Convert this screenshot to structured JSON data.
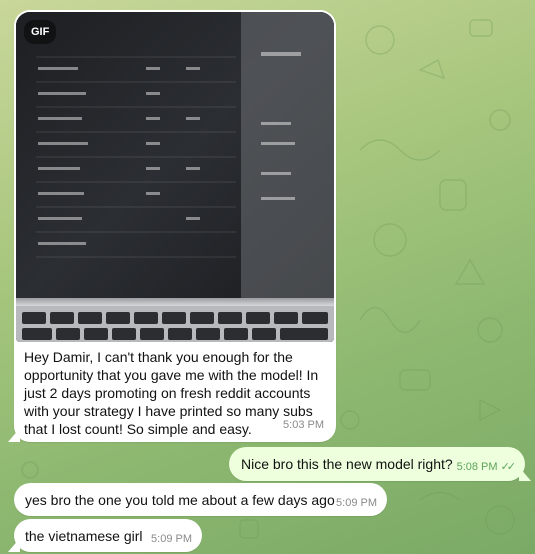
{
  "gif_badge": "GIF",
  "media_message": {
    "text": "Hey Damir, I can't thank you enough for the opportunity that you gave me with the model! In just 2 days promoting on fresh reddit accounts with your strategy I have printed so many subs that I lost count! So simple and easy.",
    "time": "5:03 PM"
  },
  "outgoing": {
    "text": "Nice bro this the new model right?",
    "time": "5:08 PM"
  },
  "incoming": [
    {
      "text": "yes bro the one you told me about a few days ago",
      "time": "5:09 PM"
    },
    {
      "text": "the vietnamese girl",
      "time": "5:09 PM"
    }
  ],
  "colors": {
    "incoming_bubble": "#ffffff",
    "outgoing_bubble": "#eeffde",
    "read_checks": "#5fa35a"
  },
  "icons": [
    "double-check-icon"
  ]
}
